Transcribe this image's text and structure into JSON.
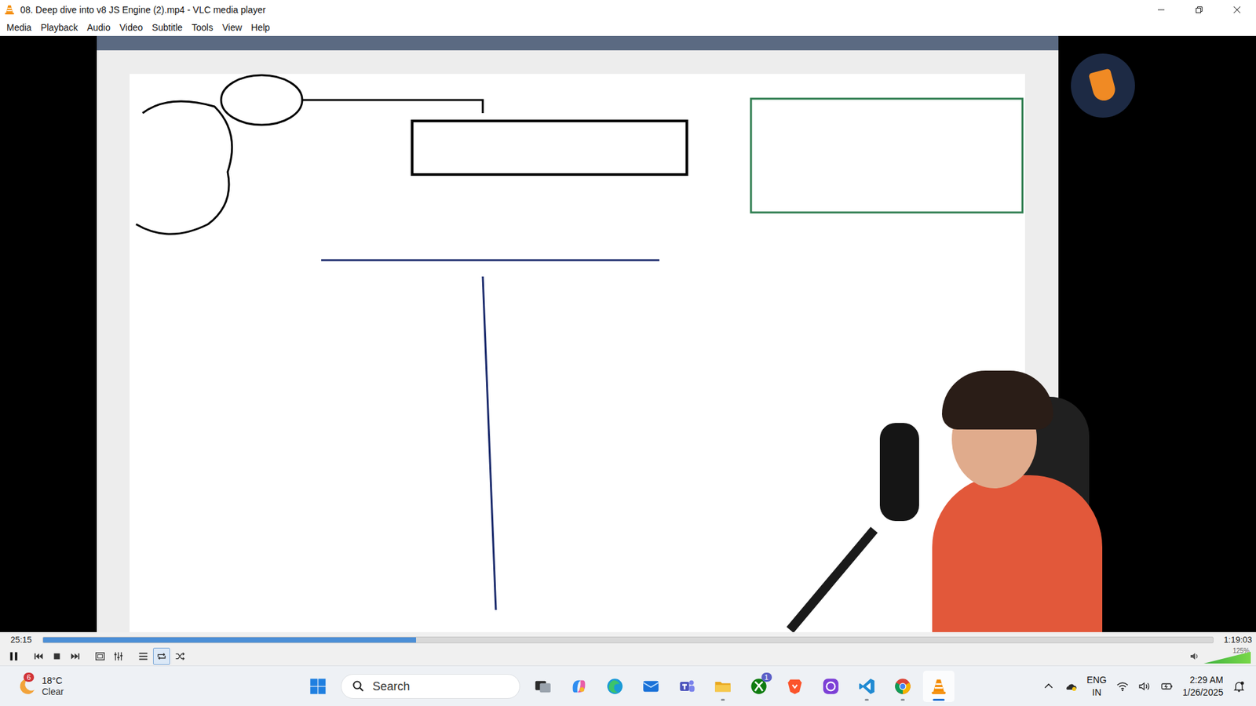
{
  "window": {
    "title": "08. Deep dive into v8 JS Engine (2).mp4 - VLC media player"
  },
  "menu": [
    "Media",
    "Playback",
    "Audio",
    "Video",
    "Subtitle",
    "Tools",
    "View",
    "Help"
  ],
  "seek": {
    "current": "25:15",
    "total": "1:19:03",
    "level": 0.319
  },
  "controls": [
    {
      "kind": "pause",
      "on": false
    },
    {
      "kind": "previous",
      "on": false
    },
    {
      "kind": "stop",
      "on": false
    },
    {
      "kind": "next",
      "on": false
    },
    {
      "kind": "fullscreen",
      "on": false
    },
    {
      "kind": "extended",
      "on": false
    },
    {
      "kind": "playlist",
      "on": false
    },
    {
      "kind": "loop",
      "on": true
    },
    {
      "kind": "shuffle",
      "on": false
    }
  ],
  "volume": {
    "level": 1,
    "reading": "125%"
  },
  "taskbar": {
    "weather": {
      "temperature": "18°C",
      "condition": "Clear",
      "badge": "6"
    },
    "search": {
      "placeholder": "Search"
    },
    "apps": [
      {
        "kind": "taskview",
        "badge": "",
        "running": false,
        "selected": false
      },
      {
        "kind": "copilot",
        "badge": "",
        "running": false,
        "selected": false
      },
      {
        "kind": "edge",
        "badge": "",
        "running": false,
        "selected": false
      },
      {
        "kind": "mail",
        "badge": "",
        "running": false,
        "selected": false
      },
      {
        "kind": "teams",
        "badge": "",
        "running": false,
        "selected": false
      },
      {
        "kind": "explorer",
        "badge": "",
        "running": true,
        "selected": false
      },
      {
        "kind": "xbox",
        "badge": "1",
        "running": false,
        "selected": false
      },
      {
        "kind": "brave",
        "badge": "",
        "running": false,
        "selected": false
      },
      {
        "kind": "chat",
        "badge": "",
        "running": false,
        "selected": false
      },
      {
        "kind": "vscode",
        "badge": "",
        "running": true,
        "selected": false
      },
      {
        "kind": "chrome",
        "badge": "",
        "running": true,
        "selected": false
      },
      {
        "kind": "vlc",
        "badge": "",
        "running": true,
        "selected": true
      }
    ],
    "tray": {
      "language": "ENG",
      "region": "IN",
      "time": "2:29 AM",
      "date": "1/26/2025"
    }
  }
}
